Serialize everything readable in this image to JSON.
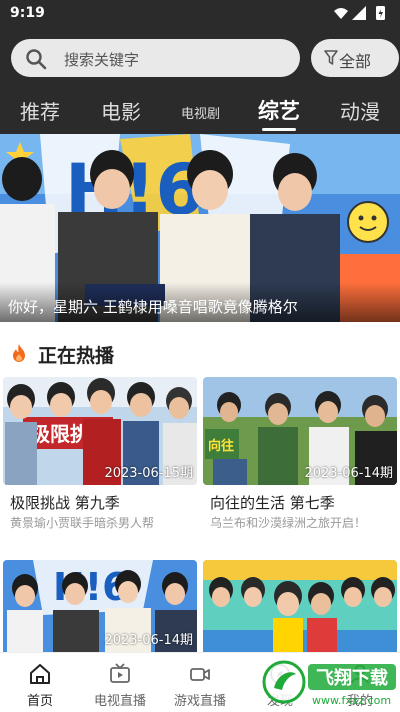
{
  "status": {
    "time": "9:19"
  },
  "search": {
    "placeholder": "搜索关键字"
  },
  "filter": {
    "label": "全部"
  },
  "tabs": [
    {
      "label": "推荐"
    },
    {
      "label": "电影"
    },
    {
      "label": "电视剧"
    },
    {
      "label": "综艺"
    },
    {
      "label": "动漫"
    }
  ],
  "banner": {
    "caption": "你好，星期六 王鹤棣用嗓音唱歌竟像腾格尔"
  },
  "section": {
    "title": "正在热播"
  },
  "cards": [
    {
      "title": "极限挑战 第九季",
      "subtitle": "黄景瑜小贾联手暗杀男人帮",
      "date": "2023-06-15期"
    },
    {
      "title": "向往的生活 第七季",
      "subtitle": "乌兰布和沙漠绿洲之旅开启！",
      "date": "2023-06-14期"
    },
    {
      "title": "",
      "subtitle": "",
      "date": "2023-06-14期"
    },
    {
      "title": "",
      "subtitle": "",
      "date": ""
    }
  ],
  "nav": [
    {
      "label": "首页"
    },
    {
      "label": "电视直播"
    },
    {
      "label": "游戏直播"
    },
    {
      "label": "发现"
    },
    {
      "label": "我的"
    }
  ],
  "watermark": {
    "text": "飞翔下载",
    "url_text": "www.fxxz.com"
  },
  "colors": {
    "header_bg": "#2b2b2b",
    "accent_orange": "#f26a1b",
    "watermark_green": "#1faa3a"
  }
}
